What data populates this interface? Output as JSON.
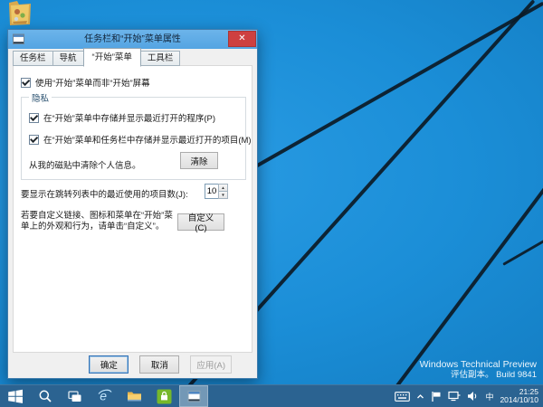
{
  "desktop": {
    "watermark_line1": "Windows Technical Preview",
    "watermark_line2": "评估副本。 Build 9841"
  },
  "dialog": {
    "title": "任务栏和“开始”菜单属性",
    "close_glyph": "✕",
    "tabs": [
      {
        "label": "任务栏"
      },
      {
        "label": "导航"
      },
      {
        "label": "“开始”菜单"
      },
      {
        "label": "工具栏"
      }
    ],
    "content": {
      "use_start_menu_label": "使用“开始”菜单而非“开始”屏幕",
      "privacy_group_label": "隐私",
      "store_programs_label": "在“开始”菜单中存储并显示最近打开的程序(P)",
      "store_items_label": "在“开始”菜单和任务栏中存储并显示最近打开的项目(M)",
      "clear_tiles_label": "从我的磁贴中清除个人信息。",
      "clear_button": "清除",
      "jumplist_label": "要显示在跳转列表中的最近使用的项目数(J):",
      "jumplist_value": "10",
      "spinner_up_glyph": "▲",
      "spinner_down_glyph": "▼",
      "customize_text": "若要自定义链接、图标和菜单在“开始”菜单上的外观和行为，请单击“自定义”。",
      "customize_button": "自定义(C)"
    },
    "footer": {
      "ok": "确定",
      "cancel": "取消",
      "apply": "应用(A)"
    }
  },
  "taskbar": {
    "buttons": [
      {
        "icon": "start-icon"
      },
      {
        "icon": "search-icon"
      },
      {
        "icon": "task-view-icon"
      },
      {
        "icon": "internet-explorer-icon"
      },
      {
        "icon": "file-explorer-icon"
      },
      {
        "icon": "store-icon"
      },
      {
        "icon": "taskbar-properties-window-icon"
      }
    ],
    "tray": {
      "language_indicator": "中",
      "time": "21:25",
      "date": "2014/10/10"
    }
  },
  "colors": {
    "wallpaper_blue": "#1b8ed7",
    "beam_dark": "#0c1a26",
    "titlebar_accent": "#5fa9e4",
    "close_red": "#ce4040",
    "taskbar_blue": "#2b6391",
    "store_green": "#76b82a"
  }
}
